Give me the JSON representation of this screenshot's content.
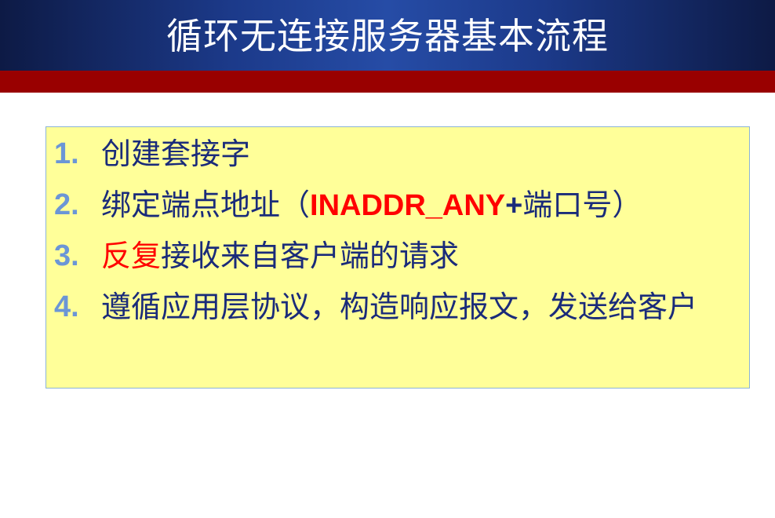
{
  "slide": {
    "title": "循环无连接服务器基本流程"
  },
  "colors": {
    "header_blue": "#1c3a8a",
    "band_red": "#990000",
    "box_fill": "#ffff99",
    "number_blue": "#6b96d6",
    "text_navy": "#1a2b7a",
    "highlight_red": "#ff0000"
  },
  "steps": [
    {
      "number": "1.",
      "text": "创建套接字"
    },
    {
      "number": "2.",
      "text_before": "绑定端点地址（",
      "highlight": "INADDR_ANY",
      "plus": "+",
      "text_after": "端口号）"
    },
    {
      "number": "3.",
      "highlight": "反复",
      "text": "接收来自客户端的请求"
    },
    {
      "number": "4.",
      "text": "遵循应用层协议，构造响应报文，发送给客户"
    }
  ]
}
